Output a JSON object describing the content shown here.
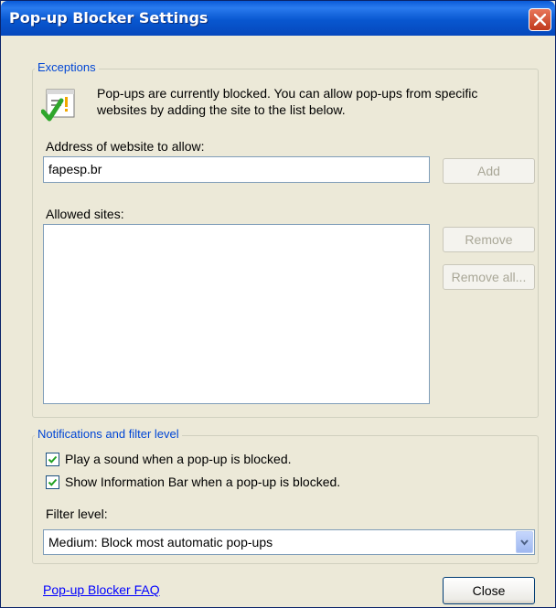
{
  "window": {
    "title": "Pop-up Blocker Settings"
  },
  "exceptions": {
    "legend": "Exceptions",
    "info_line1": "Pop-ups are currently blocked.  You can allow pop-ups from specific",
    "info_line2": "websites by adding the site to the list below.",
    "address_label": "Address of website to allow:",
    "address_value": "fapesp.br",
    "add_label": "Add",
    "allowed_label": "Allowed sites:",
    "allowed_sites": [],
    "remove_label": "Remove",
    "remove_all_label": "Remove all..."
  },
  "notifications": {
    "legend": "Notifications and filter level",
    "play_sound_label": "Play a sound when a pop-up is blocked.",
    "play_sound_checked": true,
    "info_bar_label": "Show Information Bar when a pop-up is blocked.",
    "info_bar_checked": true,
    "filter_label": "Filter level:",
    "filter_value": "Medium: Block most automatic pop-ups"
  },
  "footer": {
    "faq_link": "Pop-up Blocker FAQ",
    "close_label": "Close"
  },
  "icons": {
    "title_close": "close-icon",
    "info": "checkmark-warning-icon",
    "checkbox": "check-icon",
    "dropdown": "chevron-down-icon"
  },
  "colors": {
    "titlebar": "#0a5ad8",
    "legend_text": "#0046d5",
    "link": "#0000ff",
    "close_button": "#c0391d"
  }
}
